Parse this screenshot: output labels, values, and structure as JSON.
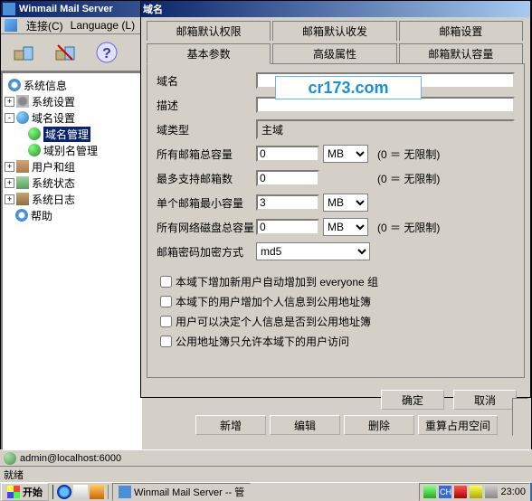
{
  "main": {
    "title": "Winmail Mail Server"
  },
  "menu": {
    "connect": "连接(C)",
    "language": "Language (L)"
  },
  "tree": {
    "sysinfo": "系统信息",
    "syscfg": "系统设置",
    "domaincfg": "域名设置",
    "domainmgr": "域名管理",
    "aliasmgr": "域别名管理",
    "usergroup": "用户和组",
    "sysstatus": "系统状态",
    "syslog": "系统日志",
    "help": "帮助"
  },
  "dlg": {
    "title": "域名",
    "tab_defperm": "邮箱默认权限",
    "tab_defrecv": "邮箱默认收发",
    "tab_mboxset": "邮箱设置",
    "tab_basic": "基本参数",
    "tab_adv": "高级属性",
    "tab_defcap": "邮箱默认容量",
    "lbl_domain": "域名",
    "lbl_desc": "描述",
    "lbl_type": "域类型",
    "val_type": "主域",
    "lbl_totalcap": "所有邮箱总容量",
    "val_totalcap": "0",
    "unit_mb": "MB",
    "hint_nolimit": "(0 ＝ 无限制)",
    "lbl_maxbox": "最多支持邮箱数",
    "val_maxbox": "0",
    "lbl_mincap": "单个邮箱最小容量",
    "val_mincap": "3",
    "lbl_netdisk": "所有网络磁盘总容量",
    "val_netdisk": "0",
    "lbl_pwdenc": "邮箱密码加密方式",
    "val_pwdenc": "md5",
    "cb1": "本域下增加新用户自动增加到 everyone 组",
    "cb2": "本域下的用户增加个人信息到公用地址簿",
    "cb3": "用户可以决定个人信息是否到公用地址簿",
    "cb4": "公用地址簿只允许本域下的用户访问",
    "btn_ok": "确定",
    "btn_cancel": "取消"
  },
  "bottom": {
    "add": "新增",
    "edit": "编辑",
    "del": "删除",
    "recalc": "重算占用空间"
  },
  "status": {
    "admin": "admin@localhost:6000",
    "ready": "就绪"
  },
  "taskbar": {
    "start": "开始",
    "task1": "Winmail Mail Server -- 管",
    "time": "23:00"
  },
  "watermark": "cr173.com",
  "tray": {
    "ime": "CH"
  }
}
